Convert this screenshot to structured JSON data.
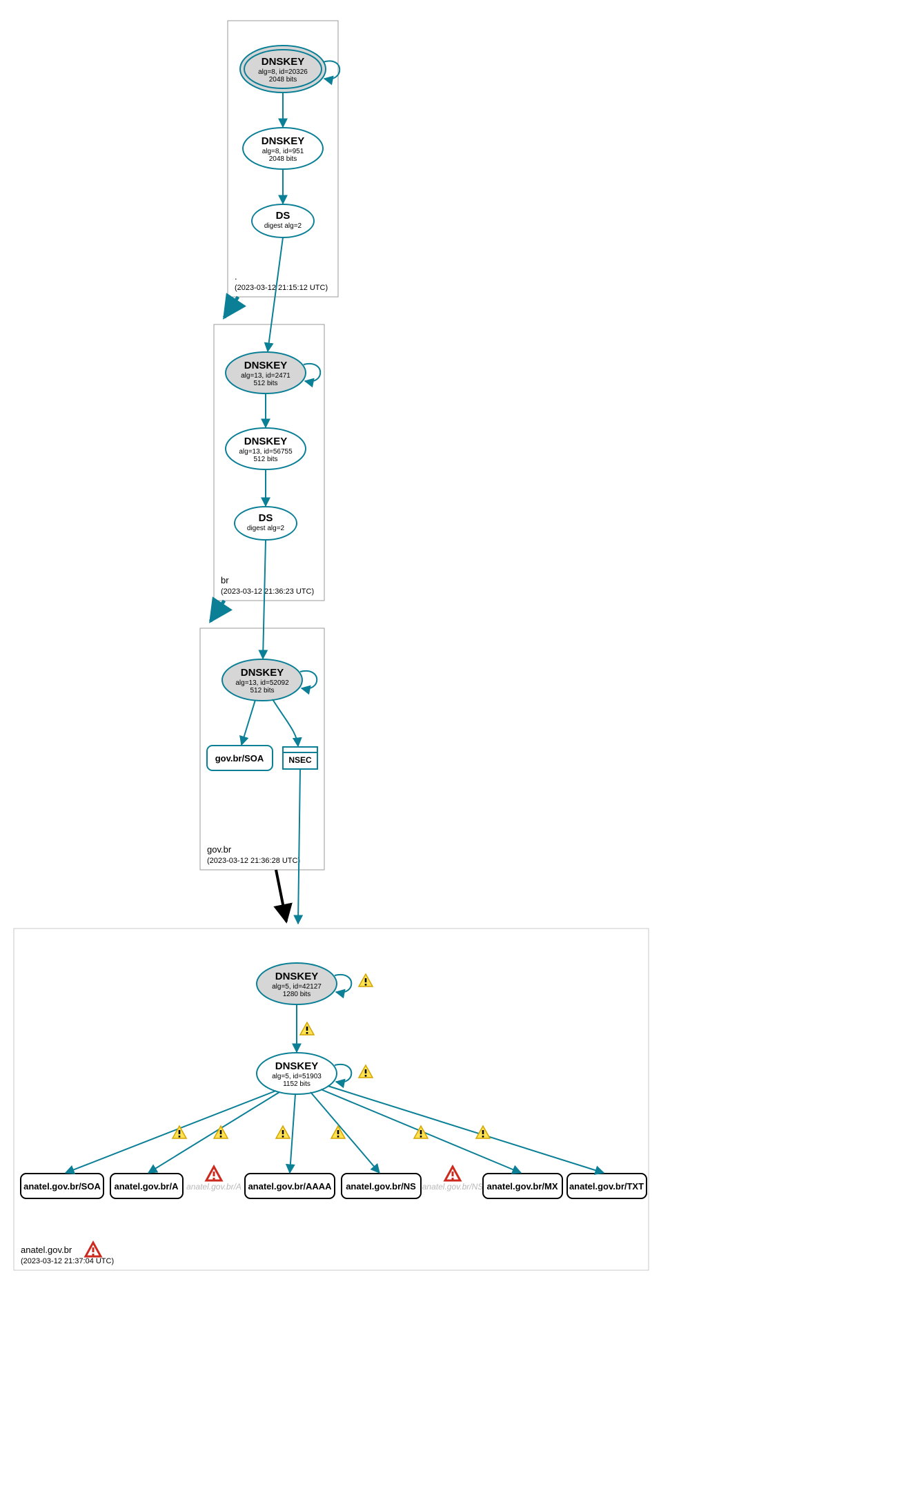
{
  "zones": {
    "root": {
      "name": ".",
      "timestamp": "(2023-03-12 21:15:12 UTC)",
      "nodes": {
        "ksk": {
          "title": "DNSKEY",
          "line1": "alg=8, id=20326",
          "line2": "2048 bits"
        },
        "zsk": {
          "title": "DNSKEY",
          "line1": "alg=8, id=951",
          "line2": "2048 bits"
        },
        "ds": {
          "title": "DS",
          "line1": "digest alg=2"
        }
      }
    },
    "br": {
      "name": "br",
      "timestamp": "(2023-03-12 21:36:23 UTC)",
      "nodes": {
        "ksk": {
          "title": "DNSKEY",
          "line1": "alg=13, id=2471",
          "line2": "512 bits"
        },
        "zsk": {
          "title": "DNSKEY",
          "line1": "alg=13, id=56755",
          "line2": "512 bits"
        },
        "ds": {
          "title": "DS",
          "line1": "digest alg=2"
        }
      }
    },
    "govbr": {
      "name": "gov.br",
      "timestamp": "(2023-03-12 21:36:28 UTC)",
      "nodes": {
        "ksk": {
          "title": "DNSKEY",
          "line1": "alg=13, id=52092",
          "line2": "512 bits"
        },
        "soa": {
          "label": "gov.br/SOA"
        },
        "nsec": {
          "label": "NSEC"
        }
      }
    },
    "anatel": {
      "name": "anatel.gov.br",
      "timestamp": "(2023-03-12 21:37:04 UTC)",
      "nodes": {
        "ksk": {
          "title": "DNSKEY",
          "line1": "alg=5, id=42127",
          "line2": "1280 bits"
        },
        "zsk": {
          "title": "DNSKEY",
          "line1": "alg=5, id=51903",
          "line2": "1152 bits"
        }
      },
      "records": [
        {
          "label": "anatel.gov.br/SOA"
        },
        {
          "label": "anatel.gov.br/A"
        },
        {
          "ghost": "anatel.gov.br/A"
        },
        {
          "label": "anatel.gov.br/AAAA"
        },
        {
          "label": "anatel.gov.br/NS"
        },
        {
          "ghost": "anatel.gov.br/NS"
        },
        {
          "label": "anatel.gov.br/MX"
        },
        {
          "label": "anatel.gov.br/TXT"
        }
      ]
    }
  }
}
